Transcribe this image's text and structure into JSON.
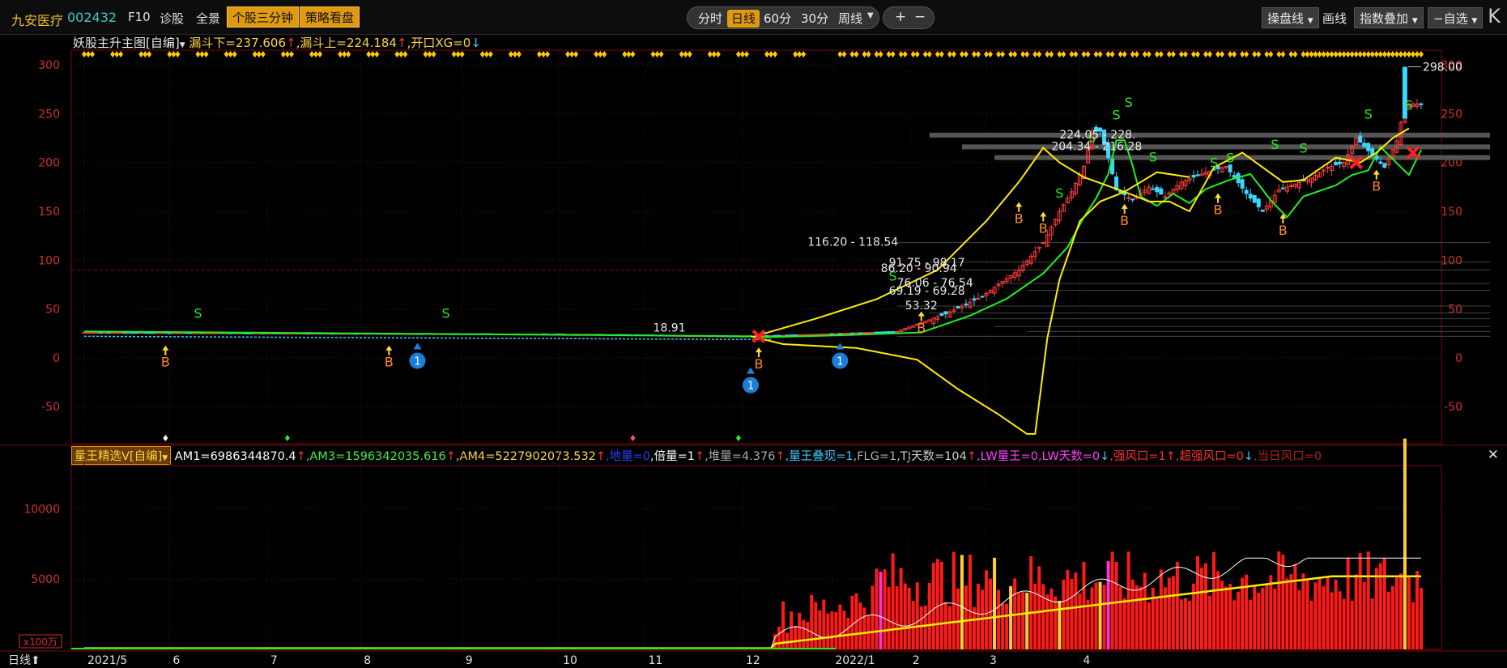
{
  "toolbar": {
    "stock_name": "九安医疗",
    "stock_code": "002432",
    "f10": "F10",
    "diagnose": "诊股",
    "panorama": "全景",
    "three_min": "个股三分钟",
    "strategy": "策略看盘",
    "periods": [
      "分时",
      "日线",
      "60分",
      "30分",
      "周线"
    ],
    "active_period": "日线",
    "zoom_in": "+",
    "zoom_out": "−",
    "trade_line": "操盘线",
    "draw_line": "画线",
    "index_overlay": "指数叠加",
    "self_select": "自选",
    "collapse": "K"
  },
  "main_indicator": {
    "name": "妖股主升主图[自编]",
    "values": [
      {
        "text": "漏斗下=237.606",
        "color": "#ffd24a"
      },
      {
        "text": "↑",
        "color": "#ff3030"
      },
      {
        "text": ",漏斗上=224.184",
        "color": "#ffd24a"
      },
      {
        "text": "↑",
        "color": "#ff3030"
      },
      {
        "text": ",开口XG=0",
        "color": "#ffd24a"
      },
      {
        "text": "↓",
        "color": "#3fc7ff"
      }
    ]
  },
  "volume_indicator": {
    "name": "量王精选V[自编]",
    "values": [
      {
        "text": "AM1=6986344870.4",
        "color": "#ffffff"
      },
      {
        "text": "↑",
        "color": "#ff3030"
      },
      {
        "text": ",AM3=1596342035.616",
        "color": "#44ee44"
      },
      {
        "text": "↑",
        "color": "#ff3030"
      },
      {
        "text": ",AM4=5227902073.532",
        "color": "#ffd24a"
      },
      {
        "text": "↑",
        "color": "#ff3030"
      },
      {
        "text": ",地量=0",
        "color": "#2244ff"
      },
      {
        "text": ",倍量=1",
        "color": "#ffffff"
      },
      {
        "text": "↑",
        "color": "#ff3030"
      },
      {
        "text": ",堆量=4.376",
        "color": "#aaaaaa"
      },
      {
        "text": "↑",
        "color": "#ff3030"
      },
      {
        "text": ",量王叠现=1",
        "color": "#3fc7ff"
      },
      {
        "text": ",FLG=1",
        "color": "#aaaaaa"
      },
      {
        "text": ",TJ天数=104",
        "color": "#cccccc"
      },
      {
        "text": "↑",
        "color": "#ff3030"
      },
      {
        "text": ",LW量王=0",
        "color": "#ff40ff"
      },
      {
        "text": ",LW天数=0",
        "color": "#ff40ff"
      },
      {
        "text": "↓",
        "color": "#3fc7ff"
      },
      {
        "text": ",强风口=1",
        "color": "#ff3030"
      },
      {
        "text": "↑",
        "color": "#ff3030"
      },
      {
        "text": ",超强风口=0",
        "color": "#ff3030"
      },
      {
        "text": "↓",
        "color": "#3fc7ff"
      },
      {
        "text": ",当日风口=0",
        "color": "#aa2020"
      }
    ]
  },
  "bottom": {
    "period_label": "日线"
  },
  "chart_data": [
    {
      "type": "candlestick",
      "y_ticks": [
        -50,
        0,
        50,
        100,
        150,
        200,
        250,
        300
      ],
      "ylim": [
        -88,
        315
      ],
      "last_price_label": "298.00",
      "x_labels": [
        "2021/5",
        "6",
        "7",
        "8",
        "9",
        "10",
        "11",
        "12",
        "2022/1",
        "2",
        "3",
        "4"
      ],
      "price_path": [
        [
          0,
          26
        ],
        [
          60,
          25
        ],
        [
          125,
          24
        ],
        [
          162,
          22
        ],
        [
          180,
          24
        ],
        [
          200,
          27
        ],
        [
          212,
          45
        ],
        [
          221,
          63
        ],
        [
          230,
          90
        ],
        [
          236,
          118
        ],
        [
          240,
          150
        ],
        [
          243,
          170
        ],
        [
          246,
          196
        ],
        [
          248,
          232
        ],
        [
          250,
          232
        ],
        [
          252,
          205
        ],
        [
          254,
          172
        ],
        [
          258,
          162
        ],
        [
          262,
          175
        ],
        [
          266,
          165
        ],
        [
          270,
          180
        ],
        [
          276,
          190
        ],
        [
          281,
          196
        ],
        [
          286,
          168
        ],
        [
          290,
          150
        ],
        [
          294,
          172
        ],
        [
          298,
          178
        ],
        [
          302,
          184
        ],
        [
          306,
          195
        ],
        [
          310,
          200
        ],
        [
          313,
          225
        ],
        [
          316,
          212
        ],
        [
          320,
          195
        ],
        [
          323,
          222
        ],
        [
          325,
          260
        ]
      ],
      "signals": {
        "S": [
          [
            28,
            41
          ],
          [
            89,
            41
          ],
          [
            199,
            79
          ],
          [
            240,
            164
          ],
          [
            248,
            221
          ],
          [
            254,
            244
          ],
          [
            257,
            257
          ],
          [
            263,
            201
          ],
          [
            278,
            195
          ],
          [
            282,
            200
          ],
          [
            293,
            214
          ],
          [
            300,
            210
          ],
          [
            316,
            245
          ],
          [
            326,
            254
          ]
        ],
        "B": [
          [
            20,
            -9
          ],
          [
            75,
            -9
          ],
          [
            166,
            -11
          ],
          [
            206,
            26
          ],
          [
            230,
            138
          ],
          [
            236,
            128
          ],
          [
            256,
            136
          ],
          [
            279,
            147
          ],
          [
            295,
            126
          ],
          [
            318,
            171
          ]
        ]
      },
      "price_labels": [
        "18.91",
        "116.20 - 118.54",
        "91.75 - 98.17",
        "86.20 - 90.94",
        "76.06 - 76.54",
        "69.19 - 69.28",
        "53.32",
        "224.05 - 228.",
        "204.34 - 216.28"
      ],
      "signal_legend": {
        "sell": "S",
        "buy": "B",
        "badge": "1"
      }
    },
    {
      "type": "bar",
      "y_ticks": [
        5000,
        10000
      ],
      "unit_label": "x100万",
      "series": [
        "volume",
        "AM1",
        "AM3",
        "AM4"
      ]
    }
  ]
}
